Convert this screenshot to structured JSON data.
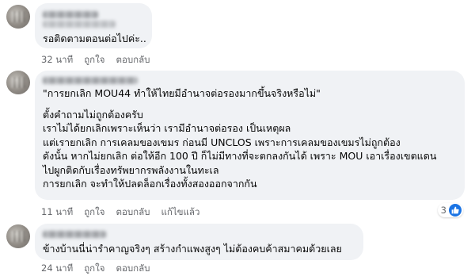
{
  "comments": [
    {
      "text_lines": [
        "รอติดตามตอนต่อไปค่ะ.."
      ],
      "time": "32 นาที",
      "like_label": "ถูกใจ",
      "reply_label": "ตอบกลับ"
    },
    {
      "text_lines": [
        "\"การยกเลิก MOU44 ทำให้ไทยมีอำนาจต่อรองมากขึ้นจริงหรือไม่\"",
        "",
        "ตั้งคำถามไม่ถูกต้องครับ",
        "เราไม่ได้ยกเลิกเพราะเห็นว่า เรามีอำนาจต่อรอง เป็นเหตุผล",
        "แต่เรายกเลิก การเคลมของเขมร ก่อนมี UNCLOS เพราะการเคลมของเขมรไม่ถูกต้อง",
        "ดังนั้น หากไม่ยกเลิก ต่อให้อีก 100 ปี ก็ไม่มีทางที่จะตกลงกันได้ เพราะ MOU เอาเรื่องเขตแดน",
        "ไปผูกติดกับเรื่องทรัพยากรพลังงานในทะเล",
        "การยกเลิก จะทำให้ปลดล็อกเรื่องทั้งสองออกจากกัน"
      ],
      "time": "11 นาที",
      "like_label": "ถูกใจ",
      "reply_label": "ตอบกลับ",
      "edited_label": "แก้ไขแล้ว",
      "reaction_count": "3",
      "reaction_icon": "like-thumb-icon"
    },
    {
      "text_lines": [
        "ข้างบ้านนี่น่ารำคาญจริงๆ สร้างกำแพงสูงๆ ไม่ต้องคบค้าสมาคมด้วยเลย"
      ],
      "time": "24 นาที",
      "like_label": "ถูกใจ",
      "reply_label": "ตอบกลับ"
    }
  ],
  "colors": {
    "bubble": "#f0f2f5",
    "meta_text": "#65676b",
    "like_blue": "#1b74e4"
  }
}
